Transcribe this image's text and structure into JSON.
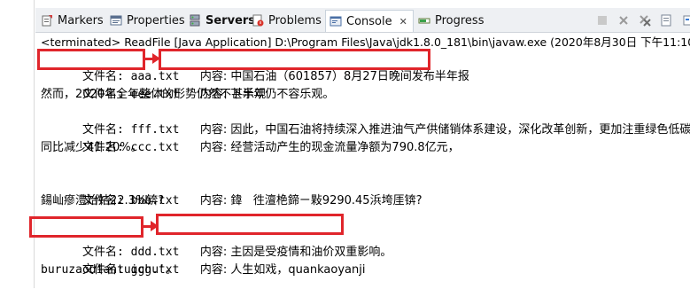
{
  "tabs": [
    {
      "label": "Markers",
      "icon": "markers-icon"
    },
    {
      "label": "Properties",
      "icon": "properties-icon"
    },
    {
      "label": "Servers",
      "icon": "servers-icon",
      "bold": true
    },
    {
      "label": "Problems",
      "icon": "problems-icon"
    },
    {
      "label": "Console",
      "icon": "console-icon",
      "active": true
    },
    {
      "label": "Progress",
      "icon": "progress-icon"
    }
  ],
  "console_tab_close": "✕",
  "status": "<terminated> ReadFile [Java Application] D:\\Program Files\\Java\\jdk1.8.0_181\\bin\\javaw.exe (2020年8月30日 下午11:10:47)",
  "lines": [
    {
      "name": "文件名: aaa.txt",
      "content": "内容: 中国石油（601857）8月27日晚间发布半年报"
    },
    {
      "name": "文件名: eee.txt",
      "content": "内容: 下半年仍不容乐观。"
    },
    {
      "text": "然而，2020年全年整体的形势仍然不甚乐观"
    },
    {
      "name": "文件名: fff.txt",
      "content": "内容: 因此，中国石油将持续深入推进油气产供储销体系建设，深化改革创新，更加注重绿色低碳发展"
    },
    {
      "name": "文件名: ccc.txt",
      "content": "内容: 经营活动产生的现金流量净额为790.8亿元，"
    },
    {
      "text": "同比减少41.20%。"
    },
    {
      "text": ""
    },
    {
      "name": "文件名: bbb.txt",
      "content": "内容: 鍏   徃澶栬鍗ㄧ敤9290.45浜垮厓锛?"
    },
    {
      "text": "鍚屾瘮澧炲姞22.3%锛?"
    },
    {
      "text": ""
    },
    {
      "name": "文件名: ddd.txt",
      "content": "内容: 主因是受疫情和油价双重影响。"
    },
    {
      "name": "文件名: ggg.txt",
      "content": "内容: 人生如戏，quankaoyanji"
    },
    {
      "text": "buruzaodiantuichu'。"
    }
  ],
  "colors": {
    "highlight": "#e0252b",
    "tabbar_bg": "#eef0f3"
  }
}
